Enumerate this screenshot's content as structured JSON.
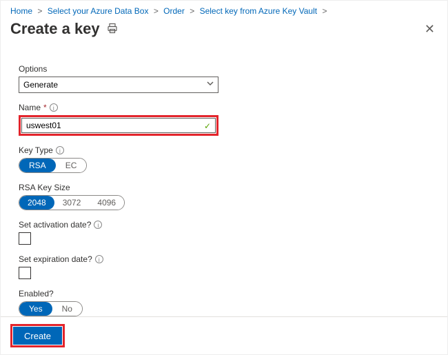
{
  "breadcrumb": {
    "items": [
      "Home",
      "Select your Azure Data Box",
      "Order",
      "Select key from Azure Key Vault"
    ]
  },
  "page": {
    "title": "Create a key"
  },
  "form": {
    "options": {
      "label": "Options",
      "value": "Generate"
    },
    "name": {
      "label": "Name",
      "value": "uswest01",
      "required": "*"
    },
    "keyType": {
      "label": "Key Type",
      "opts": [
        "RSA",
        "EC"
      ],
      "selected": "RSA"
    },
    "rsaKeySize": {
      "label": "RSA Key Size",
      "opts": [
        "2048",
        "3072",
        "4096"
      ],
      "selected": "2048"
    },
    "activation": {
      "label": "Set activation date?"
    },
    "expiration": {
      "label": "Set expiration date?"
    },
    "enabled": {
      "label": "Enabled?",
      "opts": [
        "Yes",
        "No"
      ],
      "selected": "Yes"
    }
  },
  "footer": {
    "create_label": "Create"
  }
}
